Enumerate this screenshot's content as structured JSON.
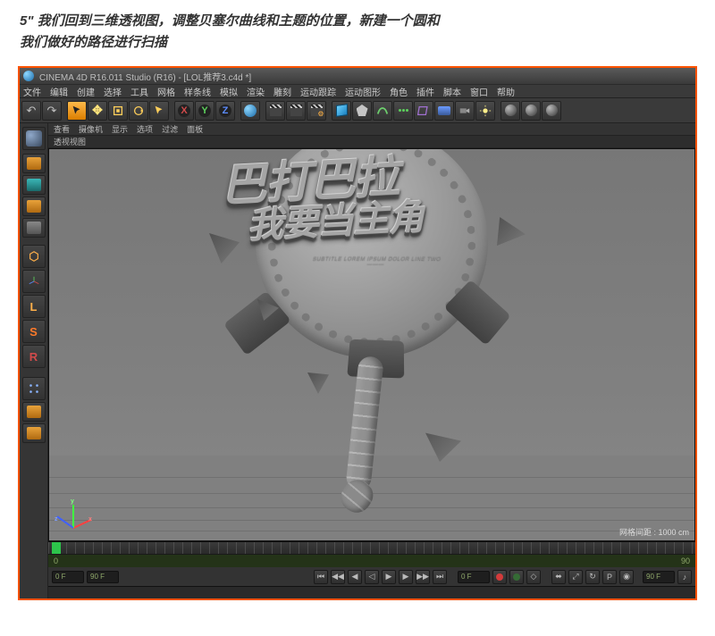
{
  "instruction": {
    "line1": "5\" 我们回到三维透视图，调整贝塞尔曲线和主题的位置，新建一个圆和",
    "line2": "我们做好的路径进行扫描"
  },
  "titlebar": {
    "text": "CINEMA 4D R16.011 Studio (R16) - [LOL推荐3.c4d *]"
  },
  "menus": {
    "file": "文件",
    "edit": "编辑",
    "create": "创建",
    "select": "选择",
    "tools": "工具",
    "mesh": "网格",
    "spline": "样条线",
    "simulate": "模拟",
    "render": "渲染",
    "sculpt": "雕刻",
    "mograph": "运动跟踪",
    "motion": "运动图形",
    "char": "角色",
    "plugins": "插件",
    "script": "脚本",
    "window": "窗口",
    "help": "帮助"
  },
  "axis": {
    "x": "X",
    "y": "Y",
    "z": "Z"
  },
  "left_tool": {
    "live": "L",
    "snap": "S",
    "reg": "R"
  },
  "view_menu": {
    "view": "查看",
    "camera": "摄像机",
    "display": "显示",
    "options": "选项",
    "filter": "过滤",
    "panel": "面板"
  },
  "view_tab": "透视视图",
  "scene_text": {
    "line1": "巴打巴拉",
    "line2": "我要当主角",
    "sub": "SUBTITLE LOREM IPSUM DOLOR\nLINE TWO\n———"
  },
  "view_status": "网格间距 : 1000 cm",
  "axis_lbl": {
    "x": "x",
    "y": "y",
    "z": "z"
  },
  "timeline": {
    "start": "0",
    "end": "90",
    "current": "0 F",
    "range_end": "90 F"
  },
  "bottombar": {
    "f_start": "0 F",
    "f_end": "90 F",
    "f_cur": "0 F",
    "f_range": "90 F"
  }
}
